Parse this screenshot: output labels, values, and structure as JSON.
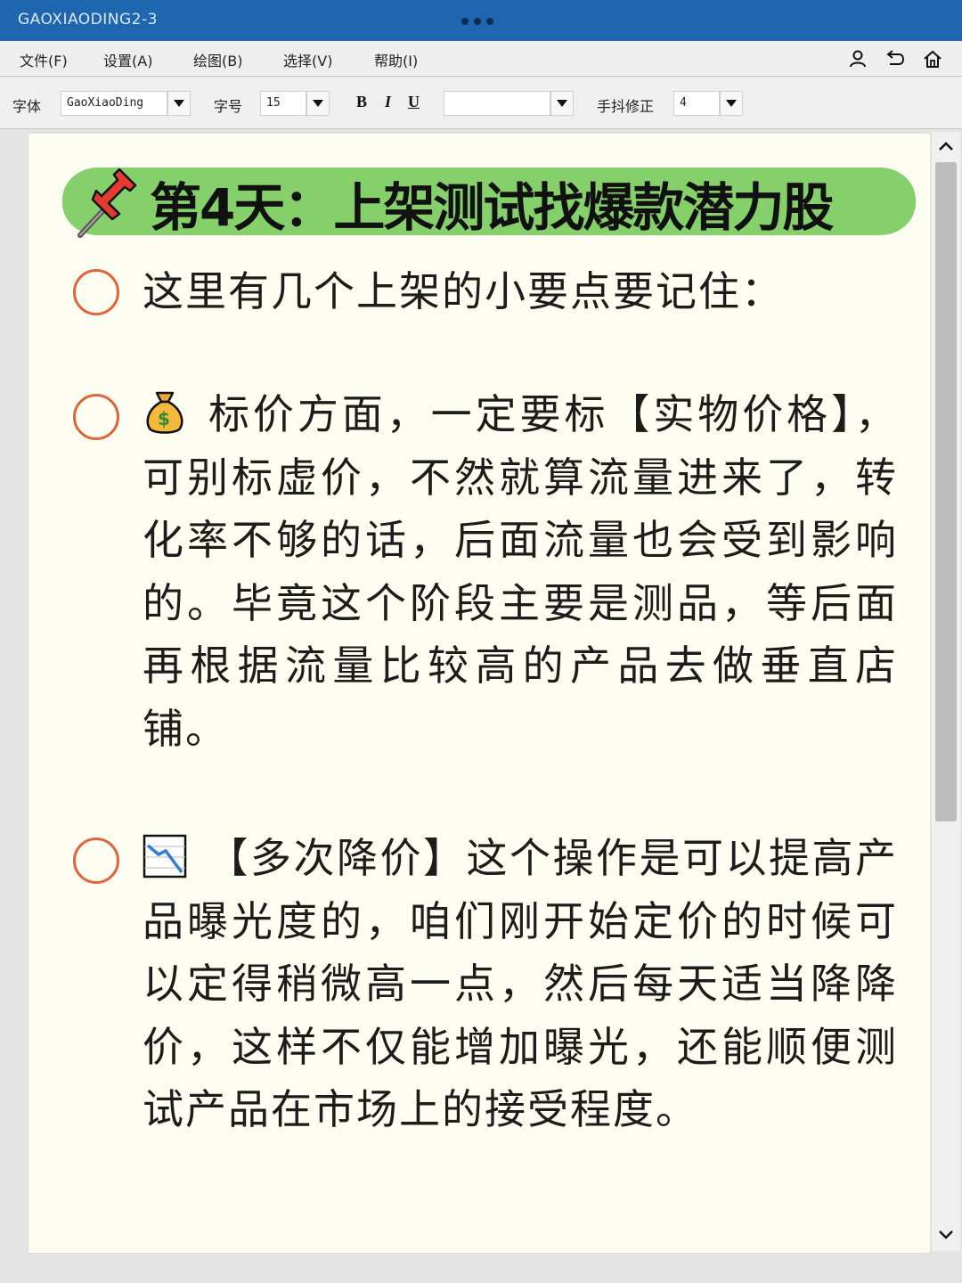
{
  "window": {
    "title": "GAOXIAODING2-3"
  },
  "menu": {
    "items": [
      "文件(F)",
      "设置(A)",
      "绘图(B)",
      "选择(V)",
      "帮助(I)"
    ]
  },
  "toolbar": {
    "font_label": "字体",
    "font_value": "GaoXiaoDing",
    "size_label": "字号",
    "size_value": "15",
    "bold": "B",
    "italic": "I",
    "underline": "U",
    "color_value": "",
    "shake_label": "手抖修正",
    "shake_value": "4"
  },
  "document": {
    "heading": "第4天：上架测试找爆款潜力股",
    "items": [
      {
        "text": "这里有几个上架的小要点要记住："
      },
      {
        "icon": "money-bag-icon",
        "text": "标价方面，一定要标【实物价格】，可别标虚价，不然就算流量进来了，转化率不够的话，后面流量也会受到影响的。毕竟这个阶段主要是测品，等后面再根据流量比较高的产品去做垂直店铺。"
      },
      {
        "icon": "chart-decreasing-icon",
        "text": "【多次降价】这个操作是可以提高产品曝光度的，咱们刚开始定价的时候可以定得稍微高一点，然后每天适当降降价，这样不仅能增加曝光，还能顺便测试产品在市场上的接受程度。"
      }
    ]
  },
  "colors": {
    "titlebar": "#1e66b0",
    "heading_highlight": "#86d06b",
    "bullet_ring": "#e0643e",
    "paper": "#fefdf1"
  }
}
